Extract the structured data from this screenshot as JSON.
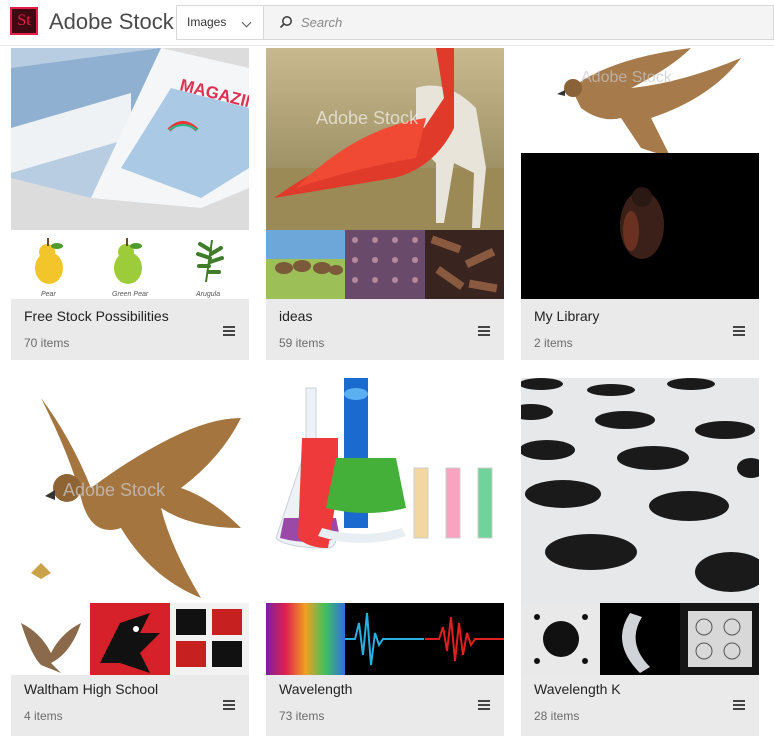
{
  "header": {
    "logo_text": "St",
    "brand": "Adobe Stock",
    "asset_type": "Images",
    "search_placeholder": "Search"
  },
  "collections": [
    {
      "title": "Free Stock Possibilities",
      "count": "70 items",
      "strip_labels": [
        "Pear",
        "Green Pear",
        "Arugula"
      ]
    },
    {
      "title": "ideas",
      "count": "59 items"
    },
    {
      "title": "My Library",
      "count": "2 items"
    },
    {
      "title": "Waltham High School",
      "count": "4 items"
    },
    {
      "title": "Wavelength",
      "count": "73 items"
    },
    {
      "title": "Wavelength K",
      "count": "28 items"
    }
  ],
  "watermark": "Adobe Stock",
  "magazine_text": "MAGAZIN",
  "colors": {
    "accent": "#e4204a",
    "card_bg": "#eaeaea"
  }
}
